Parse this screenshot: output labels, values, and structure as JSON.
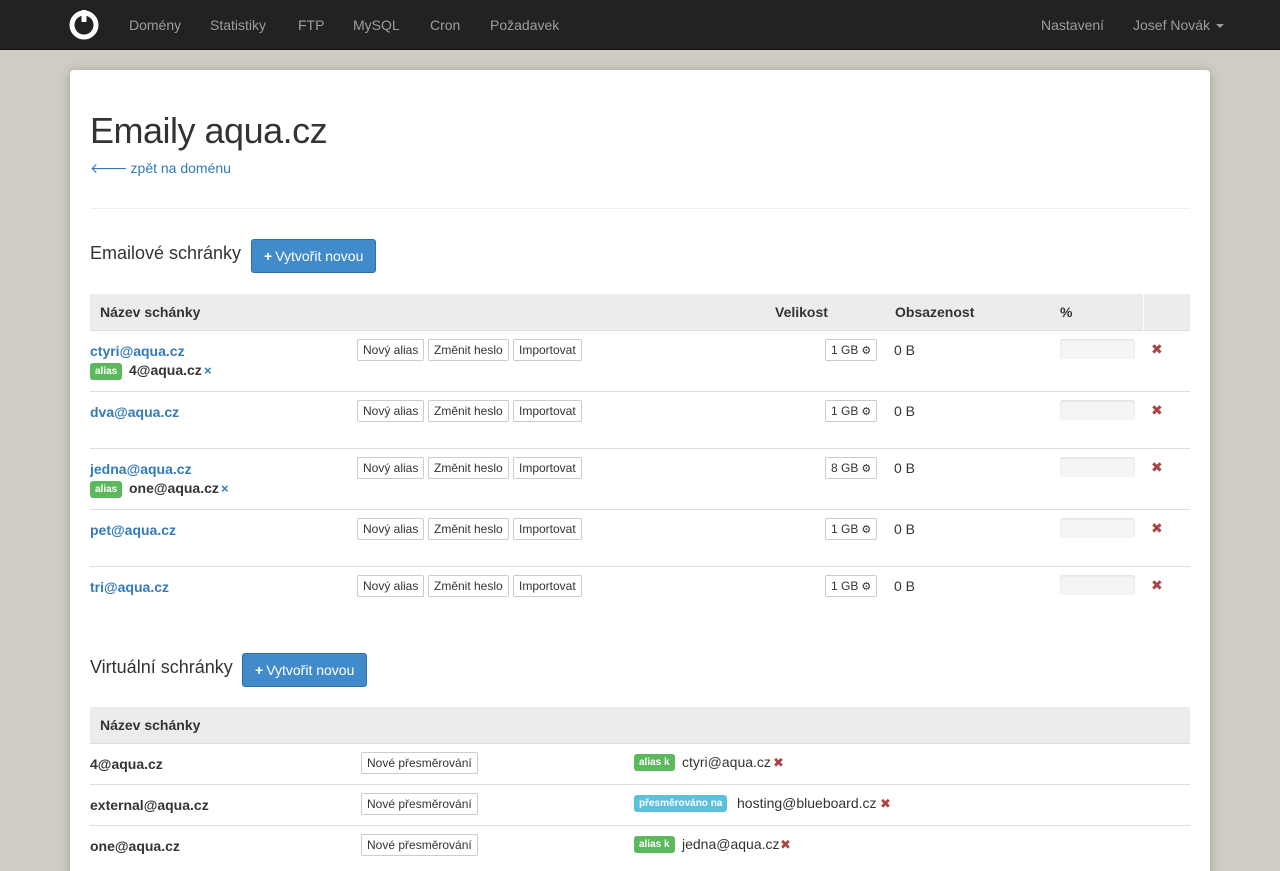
{
  "navbar": {
    "items": [
      "Domény",
      "Statistiky",
      "FTP",
      "MySQL",
      "Cron",
      "Požadavek"
    ],
    "settings": "Nastavení",
    "user": "Josef Novák"
  },
  "page": {
    "title": "Emaily aqua.cz",
    "back_link": "zpět na doménu"
  },
  "mailboxes": {
    "title": "Emailové schránky",
    "create_button": "Vytvořit novou",
    "columns": {
      "name": "Název schánky",
      "size": "Velikost",
      "usage": "Obsazenost",
      "percent": "%"
    },
    "actions": {
      "new_alias": "Nový alias",
      "change_password": "Změnit heslo",
      "import": "Importovat"
    },
    "alias_label": "alias",
    "alias_remove": "×",
    "delete_symbol": "✖",
    "rows": [
      {
        "email": "ctyri@aqua.cz",
        "alias": "4@aqua.cz",
        "size": "1 GB",
        "usage": "0 B",
        "percent": 0
      },
      {
        "email": "dva@aqua.cz",
        "alias": "",
        "size": "1 GB",
        "usage": "0 B",
        "percent": 0
      },
      {
        "email": "jedna@aqua.cz",
        "alias": "one@aqua.cz",
        "size": "8 GB",
        "usage": "0 B",
        "percent": 0
      },
      {
        "email": "pet@aqua.cz",
        "alias": "",
        "size": "1 GB",
        "usage": "0 B",
        "percent": 0
      },
      {
        "email": "tri@aqua.cz",
        "alias": "",
        "size": "1 GB",
        "usage": "0 B",
        "percent": 0
      }
    ]
  },
  "virtual": {
    "title": "Virtuální schránky",
    "create_button": "Vytvořit novou",
    "column_name": "Název schánky",
    "redirect_button": "Nové přesměrování",
    "delete_symbol": "✖",
    "rows": [
      {
        "name": "4@aqua.cz",
        "label": "alias k",
        "label_color": "#5cb85c",
        "target": "ctyri@aqua.cz"
      },
      {
        "name": "external@aqua.cz",
        "label": "přesměrováno na",
        "label_color": "#5bc0de",
        "target": "hosting@blueboard.cz"
      },
      {
        "name": "one@aqua.cz",
        "label": "alias k",
        "label_color": "#5cb85c",
        "target": "jedna@aqua.cz"
      }
    ]
  }
}
